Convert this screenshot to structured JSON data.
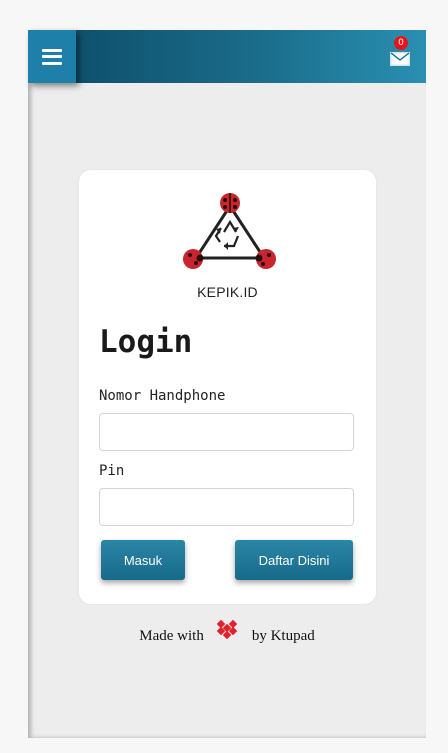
{
  "header": {
    "menu_icon": "hamburger-icon",
    "mail_icon": "envelope-icon",
    "notification_count": "0",
    "gradient": [
      "#0c4a66",
      "#2a8fb2"
    ]
  },
  "login_card": {
    "brand_name": "KEPIK.ID",
    "title": "Login",
    "phone_label": "Nomor Handphone",
    "phone_value": "",
    "pin_label": "Pin",
    "pin_value": "",
    "login_button": "Masuk",
    "register_button": "Daftar Disini"
  },
  "footer": {
    "made_with": "Made with",
    "by": "by Ktupad",
    "heart_color": "#e0202a"
  },
  "colors": {
    "accent": "#1e80a8",
    "badge": "#e8141c",
    "card": "#ffffff",
    "background": "#ededee"
  }
}
